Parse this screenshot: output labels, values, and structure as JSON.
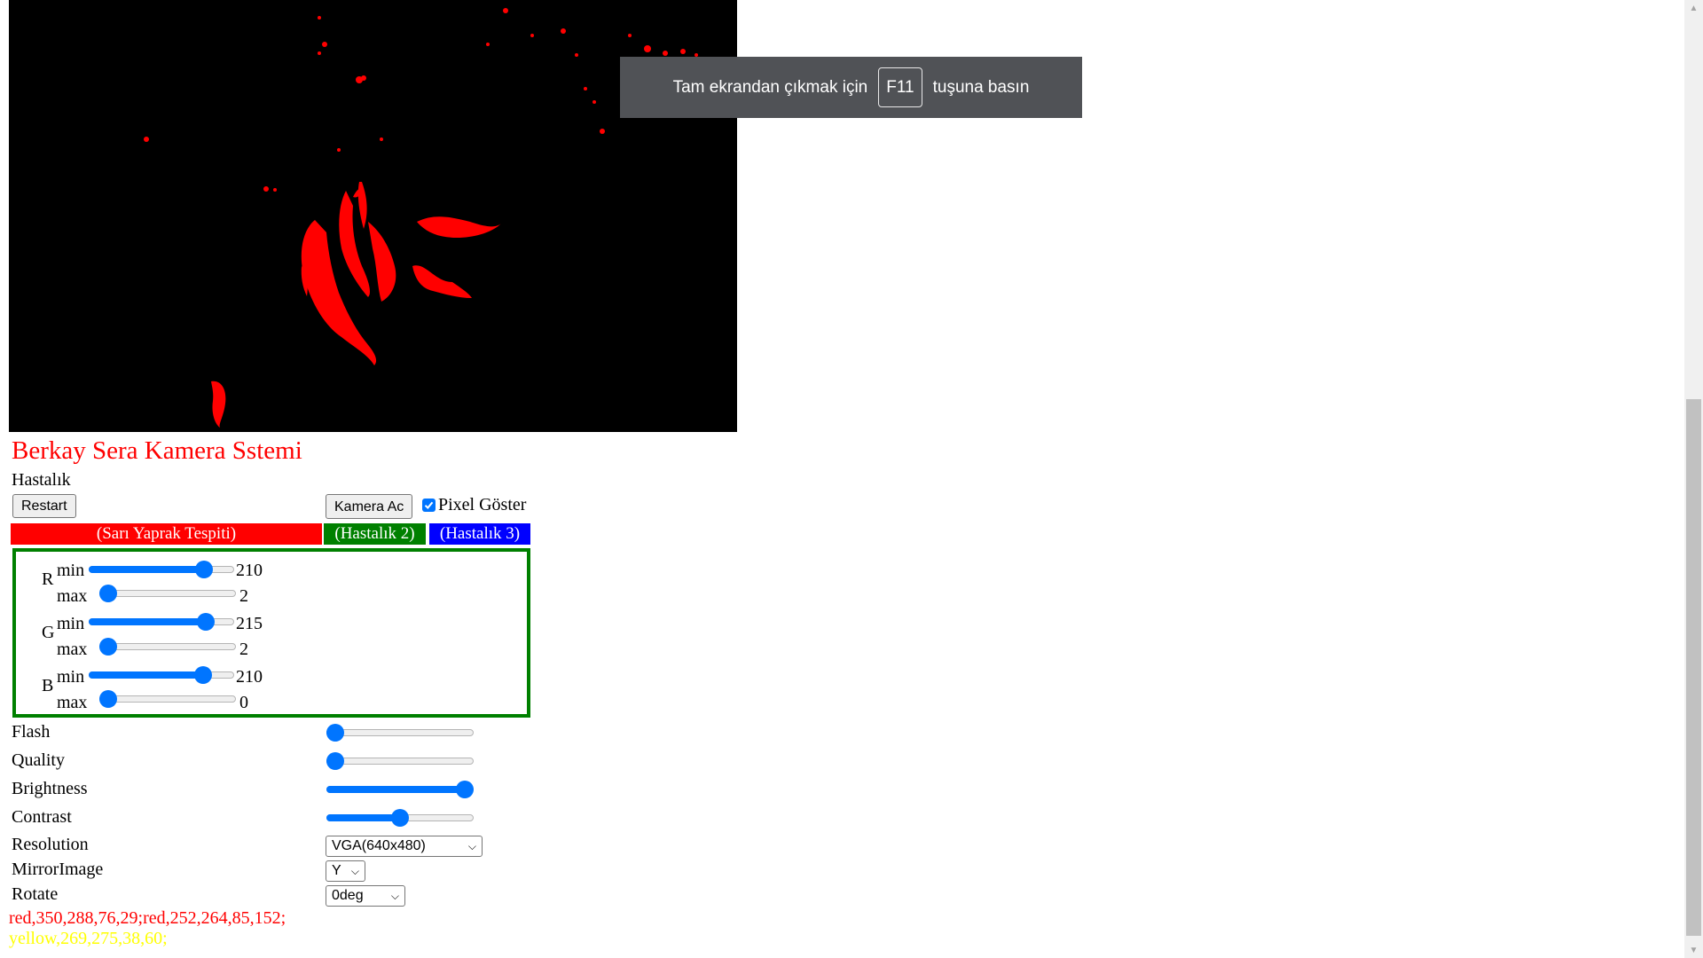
{
  "camera": {
    "mask_color": "#ff0000"
  },
  "toast": {
    "prefix": "Tam ekrandan çıkmak için",
    "key": "F11",
    "suffix": "tuşuna basın"
  },
  "title": "Berkay Sera Kamera Sstemi",
  "section_label": "Hastalık",
  "buttons": {
    "restart": "Restart",
    "camera": "Kamera Ac"
  },
  "pixel_toggle": {
    "label": "Pixel Göster",
    "checked": true
  },
  "tabs": [
    {
      "label": "(Sarı Yaprak Tespiti)",
      "color": "#ff0000"
    },
    {
      "label": "(Hastalık 2)",
      "color": "#008000"
    },
    {
      "label": "(Hastalık 3)",
      "color": "#0000ff"
    }
  ],
  "rgb": {
    "min_label": "min",
    "max_label": "max",
    "channels": [
      {
        "letter": "R",
        "min": "210",
        "max": "2"
      },
      {
        "letter": "G",
        "min": "215",
        "max": "2"
      },
      {
        "letter": "B",
        "min": "210",
        "max": "0"
      }
    ]
  },
  "controls": {
    "flash": {
      "label": "Flash",
      "level": 0
    },
    "quality": {
      "label": "Quality",
      "level": 0
    },
    "brightness": {
      "label": "Brightness",
      "level": 1
    },
    "contrast": {
      "label": "Contrast",
      "level": 0.5
    },
    "resolution": {
      "label": "Resolution",
      "value": "VGA(640x480)"
    },
    "mirror": {
      "label": "MirrorImage",
      "value": "Y"
    },
    "rotate": {
      "label": "Rotate",
      "value": "0deg"
    }
  },
  "detections": {
    "red": "red,350,288,76,29;red,252,264,85,152;",
    "yellow": "yellow,269,275,38,60;"
  },
  "colors": {
    "accent": "#0075ff",
    "panel_border": "#008000",
    "title": "#ff0000"
  }
}
